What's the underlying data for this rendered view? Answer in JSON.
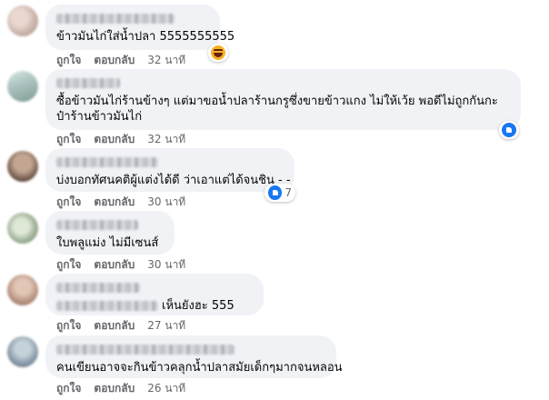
{
  "actions": {
    "like_label": "ถูกใจ",
    "reply_label": "ตอบกลับ"
  },
  "comments": [
    {
      "text": "ข้าวมันไก่ใส่น้ำปลา 5555555555",
      "time": "32 นาที",
      "reaction": "haha-icon",
      "reaction_count": ""
    },
    {
      "text": "ซื้อข้าวมันไก่ร้านข้างๆ แต่มาขอน้ำปลาร้านกรูซึ่งขายข้าวแกง ไม่ให้เว้ย พอดีไม่ถูกกันกะป๋าร้านข้าวมันไก่",
      "time": "32 นาที",
      "reaction": "like-icon",
      "reaction_count": ""
    },
    {
      "text": "บ่งบอกทัศนคติผู้แต่งได้ดี ว่าเอาแต่ได้จนชิน - -",
      "time": "30 นาที",
      "reaction": "like-icon",
      "reaction_count": "7"
    },
    {
      "text": "ใบพลูแม่ง ไม่มีเซนส์",
      "time": "30 นาที"
    },
    {
      "text": "เห็นยังฮะ 555",
      "time": "27 นาที"
    },
    {
      "text": "คนเขียนอาจจะกินข้าวคลุกน้ำปลาสมัยเด็กๆมากจนหลอน",
      "time": "26 นาที"
    }
  ],
  "colors": {
    "bubble": "#f0f2f5",
    "meta": "#65676b",
    "like": "#1877f2"
  }
}
